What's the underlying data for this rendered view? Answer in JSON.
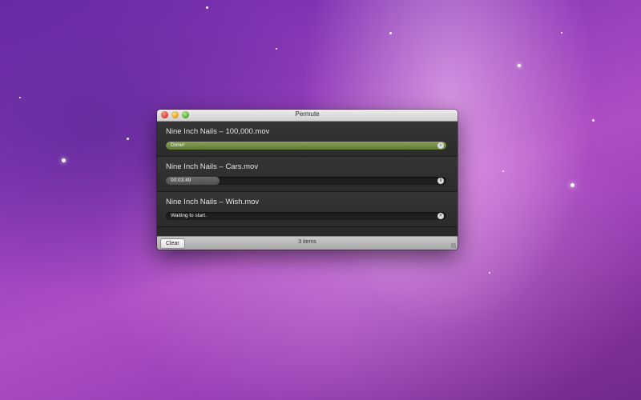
{
  "window": {
    "title": "Permute"
  },
  "items": [
    {
      "name": "Nine Inch Nails – 100,000.mov",
      "status": "Done!",
      "progress": 1.0,
      "action_icon": "reveal-arrow-icon"
    },
    {
      "name": "Nine Inch Nails – Cars.mov",
      "status": "00:03:49",
      "progress": 0.19,
      "action_icon": "pause-icon"
    },
    {
      "name": "Nine Inch Nails – Wish.mov",
      "status": "Waiting to start.",
      "progress": 0.0,
      "action_icon": "remove-icon"
    }
  ],
  "footer": {
    "clear_label": "Clear",
    "count_label": "3 items"
  }
}
